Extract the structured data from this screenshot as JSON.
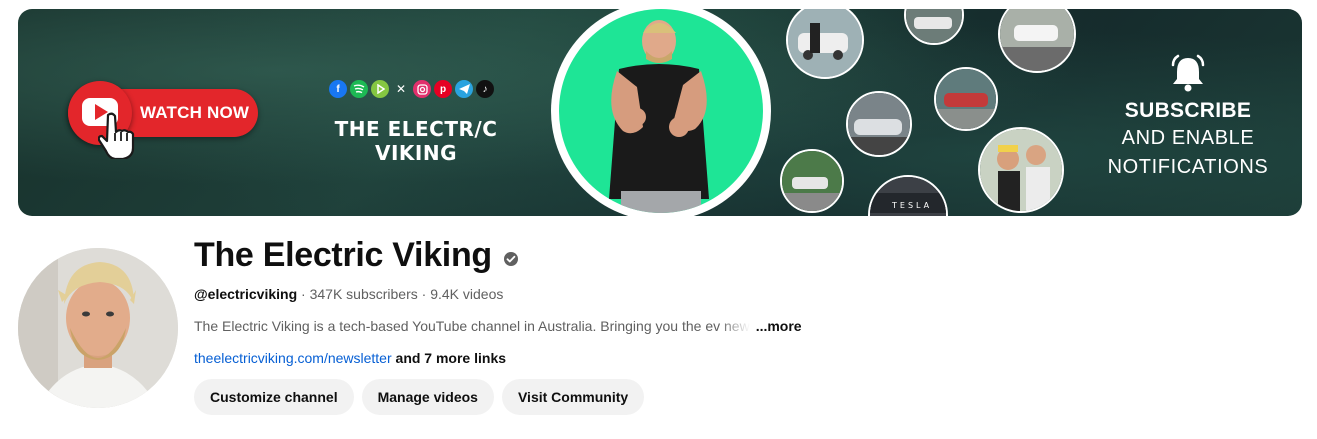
{
  "banner": {
    "watch_label": "WATCH NOW",
    "brand_title": "THE ELECTR/C VIKING",
    "social_icons": [
      "facebook-icon",
      "spotify-icon",
      "rumble-icon",
      "x-icon",
      "instagram-icon",
      "pinterest-icon",
      "telegram-icon",
      "tiktok-icon"
    ],
    "subscribe_title": "SUBSCRIBE",
    "subscribe_line1": "AND ENABLE",
    "subscribe_line2": "NOTIFICATIONS",
    "tesla_text": "TESLA",
    "colors": {
      "accent_red": "#e3262b",
      "portrait_green": "#1ee596",
      "banner_bg": "#1b3834"
    }
  },
  "channel": {
    "name": "The Electric Viking",
    "handle": "@electricviking",
    "subscribers": "347K subscribers",
    "videos": "9.4K videos",
    "separator": "·",
    "description": "The Electric Viking is a tech-based YouTube channel in Australia. Bringing you the ev",
    "description_fade": " new",
    "more_label": "...more",
    "link_url": "theelectricviking.com/newsletter",
    "more_links": "and 7 more links"
  },
  "actions": {
    "customize": "Customize channel",
    "manage": "Manage videos",
    "community": "Visit Community"
  }
}
